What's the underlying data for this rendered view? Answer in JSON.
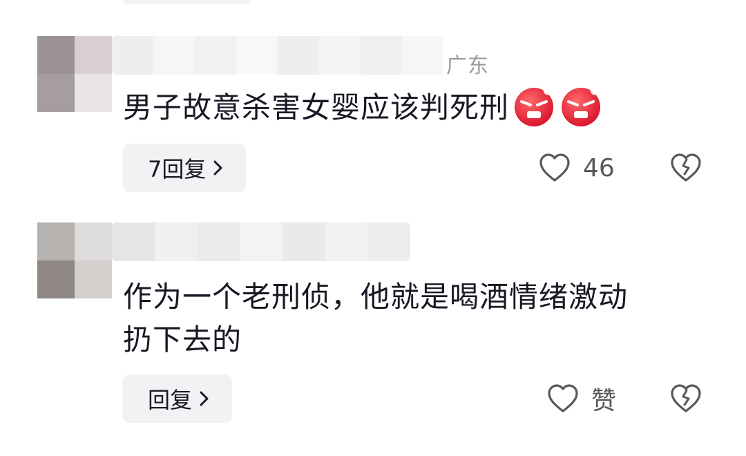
{
  "comments": [
    {
      "location": "广东",
      "text": "男子故意杀害女婴应该判死刑",
      "emojis": [
        "angry-emoji",
        "angry-emoji"
      ],
      "reply_label": "7回复",
      "like_count": "46"
    },
    {
      "location": "",
      "text_line1": "作为一个老刑侦，他就是喝酒情绪激动",
      "text_line2": "扔下去的",
      "reply_label": "回复",
      "like_count": "赞"
    }
  ],
  "icons": {
    "like": "heart-outline-icon",
    "dislike": "broken-heart-icon",
    "reply_chevron": "chevron-right-icon"
  },
  "colors": {
    "text": "#161823",
    "secondary": "#57585d",
    "location": "#9a9ba0",
    "pill_bg": "#f2f2f4",
    "emoji_red": "#e8263a"
  }
}
